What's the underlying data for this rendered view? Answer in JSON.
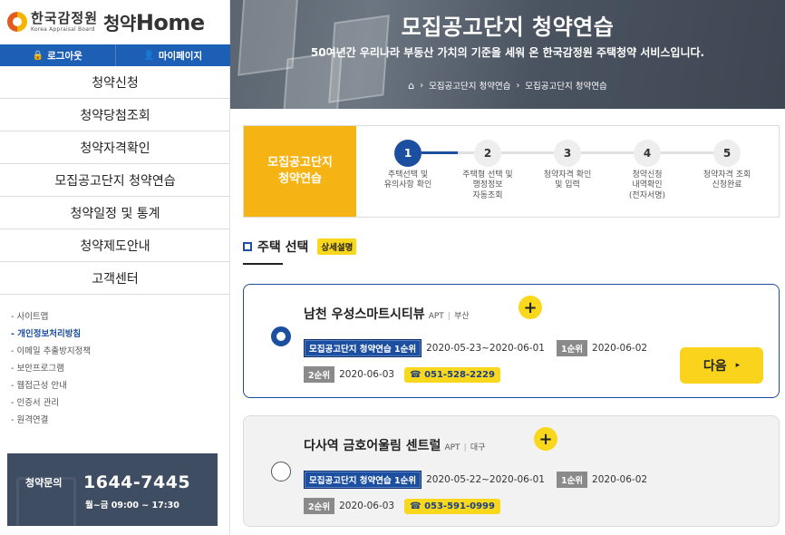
{
  "logo": {
    "ko": "한국감정원",
    "en": "Korea Appraisal Board",
    "brand_a": "청약",
    "brand_b": "Home"
  },
  "user_bar": [
    {
      "icon": "🔒",
      "label": "로그아웃"
    },
    {
      "icon": "👤",
      "label": "마이페이지"
    }
  ],
  "menu": [
    "청약신청",
    "청약당첨조회",
    "청약자격확인",
    "모집공고단지 청약연습",
    "청약일정 및 통계",
    "청약제도안내",
    "고객센터"
  ],
  "sub_links": [
    {
      "label": "- 사이트맵"
    },
    {
      "label": "- 개인정보처리방침"
    },
    {
      "label": "- 이메일 추출방지정책"
    },
    {
      "label": "- 보안프로그램"
    },
    {
      "label": "- 웹접근성 안내"
    },
    {
      "label": "- 인증서 관리"
    },
    {
      "label": "- 원격연결"
    }
  ],
  "contact": {
    "label": "청약문의",
    "phone": "1644-7445",
    "hours": "월~금 09:00 ~ 17:30"
  },
  "banner": {
    "title": "모집공고단지 청약연습",
    "subtitle": "50여년간 우리나라 부동산 가치의 기준을 세워 온 한국감정원 주택청약 서비스입니다.",
    "breadcrumb": [
      "모집공고단지 청약연습",
      "모집공고단지 청약연습"
    ]
  },
  "steps_title": "모집공고단지\n청약연습",
  "steps": [
    {
      "num": "1",
      "label": "주택선택 및\n유의사항 확인"
    },
    {
      "num": "2",
      "label": "주택형 선택 및\n행정정보\n자동조회"
    },
    {
      "num": "3",
      "label": "청약자격 확인\n및 입력"
    },
    {
      "num": "4",
      "label": "청약신청\n내역확인\n(전자서명)"
    },
    {
      "num": "5",
      "label": "청약자격 조회\n신청완료"
    }
  ],
  "active_step": 1,
  "section": {
    "title": "주택 선택",
    "badge": "상세설명"
  },
  "listings": [
    {
      "name": "남천 우성스마트시티뷰",
      "type": "APT",
      "region": "부산",
      "practice_label": "모집공고단지 청약연습 1순위",
      "practice_dates": "2020-05-23~2020-06-01",
      "rank1_label": "1순위",
      "rank1_date": "2020-06-02",
      "rank2_label": "2순위",
      "rank2_date": "2020-06-03",
      "phone": "☎ 051-528-2229",
      "selected": true
    },
    {
      "name": "다사역 금호어울림 센트럴",
      "type": "APT",
      "region": "대구",
      "practice_label": "모집공고단지 청약연습 1순위",
      "practice_dates": "2020-05-22~2020-06-01",
      "rank1_label": "1순위",
      "rank1_date": "2020-06-02",
      "rank2_label": "2순위",
      "rank2_date": "2020-06-03",
      "phone": "☎ 053-591-0999",
      "selected": false
    }
  ],
  "next_button": {
    "label": "다음",
    "arrow": "▸"
  },
  "plus_label": "+",
  "colors": {
    "primary": "#1d4fa0",
    "accent": "#f5b414",
    "yellow": "#f9d71c",
    "user_bar": "#1d5fb4",
    "contact_bg": "#3e4d61"
  }
}
